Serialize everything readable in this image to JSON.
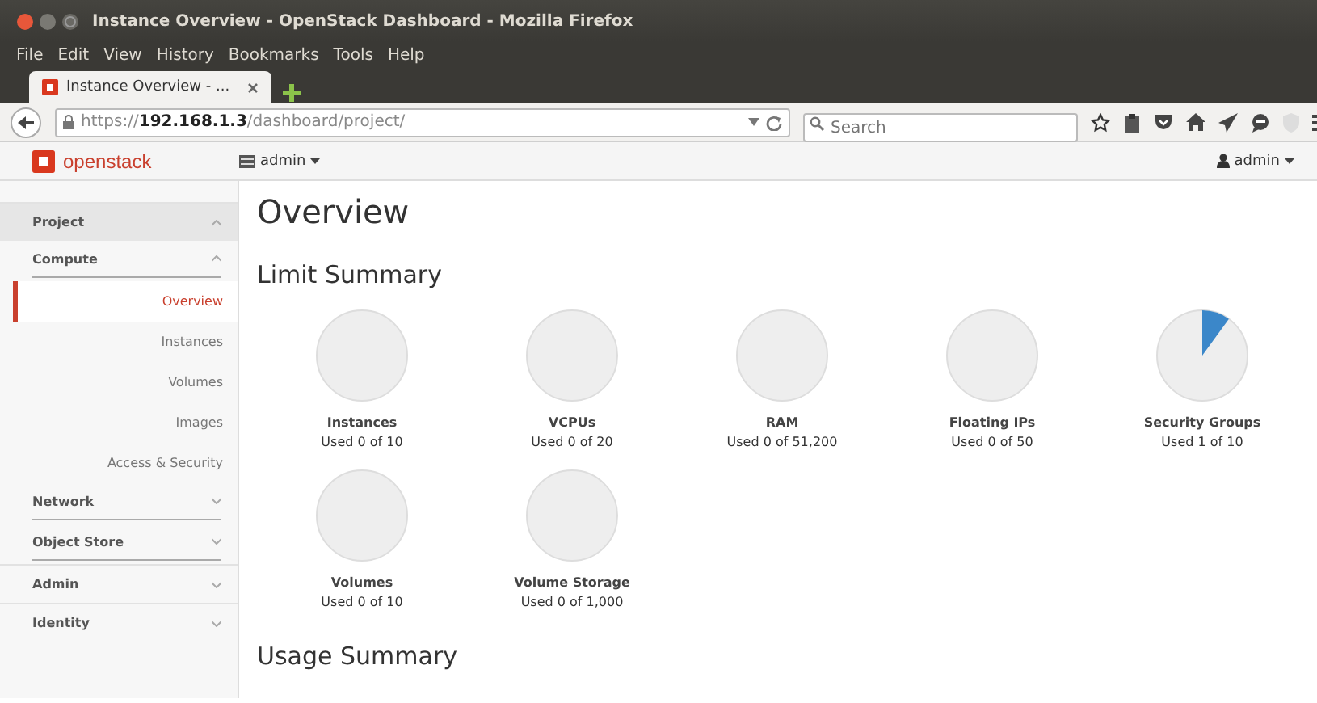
{
  "window": {
    "title": "Instance Overview - OpenStack Dashboard - Mozilla Firefox"
  },
  "menu": [
    "File",
    "Edit",
    "View",
    "History",
    "Bookmarks",
    "Tools",
    "Help"
  ],
  "tabs": [
    {
      "label": "Instance Overview - ...",
      "selected": true
    }
  ],
  "url": "https://**192.168.1.3**/dashboard/project/",
  "search": {
    "placeholder": "Search"
  },
  "header": {
    "logo": "openstack",
    "project": "admin",
    "user": "admin"
  },
  "sidebar": [
    {
      "label": "Project",
      "expanded": true,
      "children": [
        {
          "label": "Compute",
          "expanded": true,
          "children": [
            {
              "label": "Overview",
              "selected": true
            },
            {
              "label": "Instances",
              "selected": false
            },
            {
              "label": "Volumes",
              "selected": false
            },
            {
              "label": "Images",
              "selected": false
            },
            {
              "label": "Access & Security",
              "selected": false
            }
          ]
        },
        {
          "label": "Network",
          "expanded": false
        },
        {
          "label": "Object Store",
          "expanded": false
        }
      ]
    },
    {
      "label": "Admin",
      "expanded": false
    },
    {
      "label": "Identity",
      "expanded": false
    }
  ],
  "page_title": "Overview",
  "limit_heading": "Limit Summary",
  "quotas": [
    {
      "name": "Instances",
      "usage": "Used 0 of 10",
      "kind": "empty"
    },
    {
      "name": "VCPUs",
      "usage": "Used 0 of 20",
      "kind": "empty"
    },
    {
      "name": "RAM",
      "usage": "Used 0 of 51,200",
      "kind": "empty"
    },
    {
      "name": "Floating IPs",
      "usage": "Used 0 of 50",
      "kind": "empty"
    },
    {
      "name": "Security Groups",
      "usage": "Used 1 of 10",
      "kind": "partial"
    },
    {
      "name": "Volumes",
      "usage": "Used 0 of 10",
      "kind": "empty"
    },
    {
      "name": "Volume Storage",
      "usage": "Used 0 of 1,000",
      "kind": "empty"
    }
  ],
  "usage_heading": "Usage Summary"
}
